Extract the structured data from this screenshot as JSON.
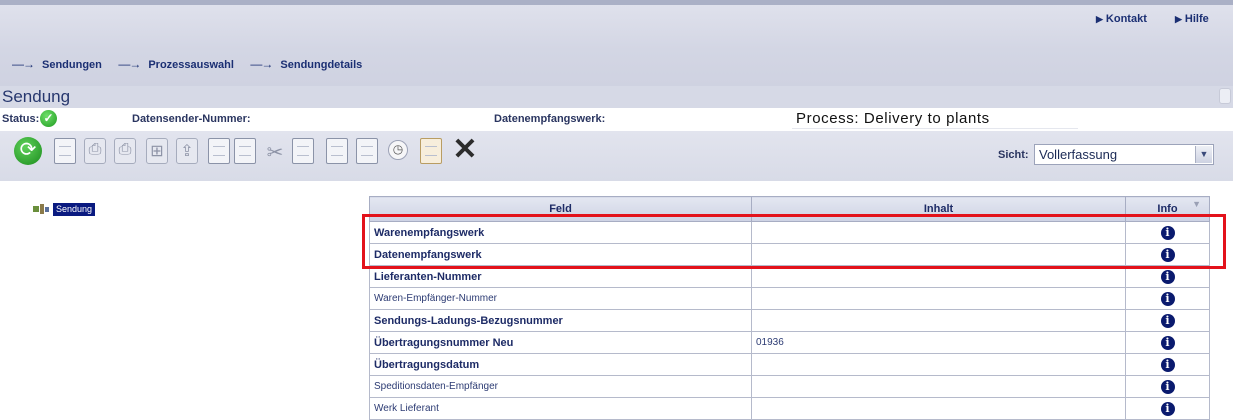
{
  "header": {
    "links": [
      {
        "label": "Kontakt"
      },
      {
        "label": "Hilfe"
      }
    ],
    "breadcrumb": [
      {
        "label": "Sendungen"
      },
      {
        "label": "Prozessauswahl"
      },
      {
        "label": "Sendungdetails"
      }
    ]
  },
  "section": {
    "title": "Sendung"
  },
  "status": {
    "status_label": "Status:",
    "sender_label": "Datensender-Nummer:",
    "receiver_label": "Datenempfangswerk:",
    "process_text": "Process:  Delivery to plants"
  },
  "toolbar": {
    "icons": [
      "refresh-icon",
      "document-icon",
      "print-icon",
      "print-icon",
      "grid-icon",
      "export-icon",
      "copy-icon",
      "paste-icon",
      "cut-icon",
      "document-icon",
      "table-icon",
      "document-icon",
      "clock-icon",
      "forward-icon",
      "delete-icon"
    ],
    "view_label": "Sicht:",
    "view_value": "Vollerfassung"
  },
  "tree": {
    "root_label": "Sendung"
  },
  "table": {
    "headers": {
      "field": "Feld",
      "content": "Inhalt",
      "info": "Info"
    },
    "rows": [
      {
        "field": "Warenempfangswerk",
        "content": "",
        "bold": true
      },
      {
        "field": "Datenempfangswerk",
        "content": "",
        "bold": true
      },
      {
        "field": "Lieferanten-Nummer",
        "content": "",
        "bold": true
      },
      {
        "field": "Waren-Empfänger-Nummer",
        "content": "",
        "bold": false
      },
      {
        "field": "Sendungs-Ladungs-Bezugsnummer",
        "content": "",
        "bold": true
      },
      {
        "field": "Übertragungsnummer Neu",
        "content": "01936",
        "bold": true
      },
      {
        "field": "Übertragungsdatum",
        "content": "",
        "bold": true
      },
      {
        "field": "Speditionsdaten-Empfänger",
        "content": "",
        "bold": false
      },
      {
        "field": "Werk Lieferant",
        "content": "",
        "bold": false
      }
    ]
  },
  "colors": {
    "highlight": "#e3121b",
    "accent": "#1b2f73"
  }
}
